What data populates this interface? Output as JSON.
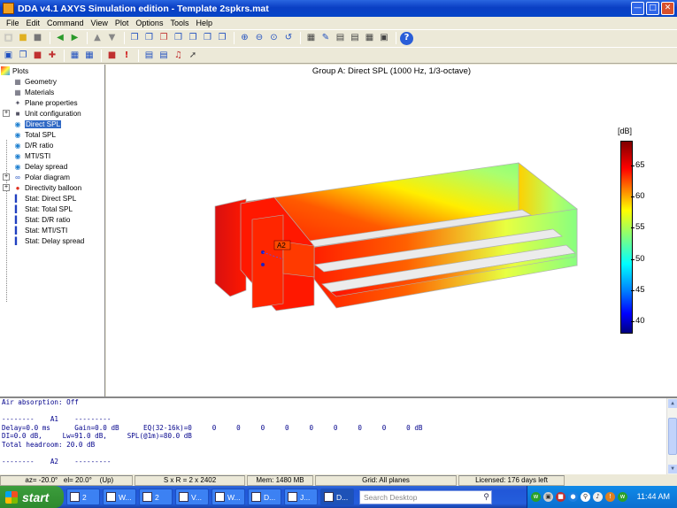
{
  "window": {
    "title": "DDA v4.1 AXYS Simulation edition - Template 2spkrs.mat"
  },
  "menu": [
    "File",
    "Edit",
    "Command",
    "View",
    "Plot",
    "Options",
    "Tools",
    "Help"
  ],
  "tree": {
    "root": "Plots",
    "items": [
      {
        "label": "Geometry",
        "icon": "geometry-icon"
      },
      {
        "label": "Materials",
        "icon": "materials-icon"
      },
      {
        "label": "Plane properties",
        "icon": "plane-properties-icon"
      },
      {
        "label": "Unit configuration",
        "icon": "unit-configuration-icon",
        "expandable": true
      },
      {
        "label": "Direct SPL",
        "icon": "spl-map-icon",
        "selected": true
      },
      {
        "label": "Total SPL",
        "icon": "spl-map-icon"
      },
      {
        "label": "D/R ratio",
        "icon": "spl-map-icon"
      },
      {
        "label": "MTI/STI",
        "icon": "spl-map-icon"
      },
      {
        "label": "Delay spread",
        "icon": "spl-map-icon"
      },
      {
        "label": "Polar diagram",
        "icon": "polar-diagram-icon",
        "expandable": true
      },
      {
        "label": "Directivity balloon",
        "icon": "balloon-icon",
        "expandable": true
      },
      {
        "label": "Stat: Direct SPL",
        "icon": "bar-chart-icon"
      },
      {
        "label": "Stat: Total SPL",
        "icon": "bar-chart-icon"
      },
      {
        "label": "Stat: D/R ratio",
        "icon": "bar-chart-icon"
      },
      {
        "label": "Stat: MTI/STI",
        "icon": "bar-chart-icon"
      },
      {
        "label": "Stat: Delay spread",
        "icon": "bar-chart-icon"
      }
    ]
  },
  "plot": {
    "title": "Group A: Direct SPL (1000 Hz, 1/3-octave)",
    "colorbar_unit": "[dB]",
    "colorbar_ticks": [
      "65",
      "60",
      "55",
      "50",
      "45",
      "40"
    ],
    "colorbar_range": [
      38,
      69
    ],
    "speaker_label": "A2",
    "colors": {
      "hot": "#ff0000",
      "mid": "#ffff00",
      "cool": "#7fff7f",
      "edge": "#b0b0b0"
    }
  },
  "console": {
    "lines": [
      "Air absorption: Off",
      "",
      "--------    A1    ---------",
      "Delay=0.0 ms      Gain=0.0 dB      EQ(32-16k)=0     0     0     0     0     0     0     0     0     0 dB",
      "DI=0.0 dB,     Lw=91.0 dB,     SPL(@1m)=80.0 dB",
      "Total headroom: 20.0 dB",
      "",
      "--------    A2    ---------"
    ]
  },
  "status": {
    "az": "   az= -20.0°   el= 20.0°    (Up)",
    "grid_size": "S x R = 2 x 2402",
    "memory": "Mem: 1480 MB",
    "grid": "Grid: All planes",
    "license": "Licensed: 176 days left"
  },
  "taskbar": {
    "start": "start",
    "tasks": [
      {
        "label": "2",
        "icon": "folder-icon"
      },
      {
        "label": "W...",
        "icon": "computer-icon"
      },
      {
        "label": "2",
        "icon": "word-icon"
      },
      {
        "label": "V...",
        "icon": "app-icon"
      },
      {
        "label": "W...",
        "icon": "browser-icon"
      },
      {
        "label": "D...",
        "icon": "app-icon"
      },
      {
        "label": "J...",
        "icon": "app-icon"
      },
      {
        "label": "D...",
        "icon": "dda-icon",
        "active": true
      }
    ],
    "search_placeholder": "Search Desktop",
    "clock": "11:44 AM"
  }
}
